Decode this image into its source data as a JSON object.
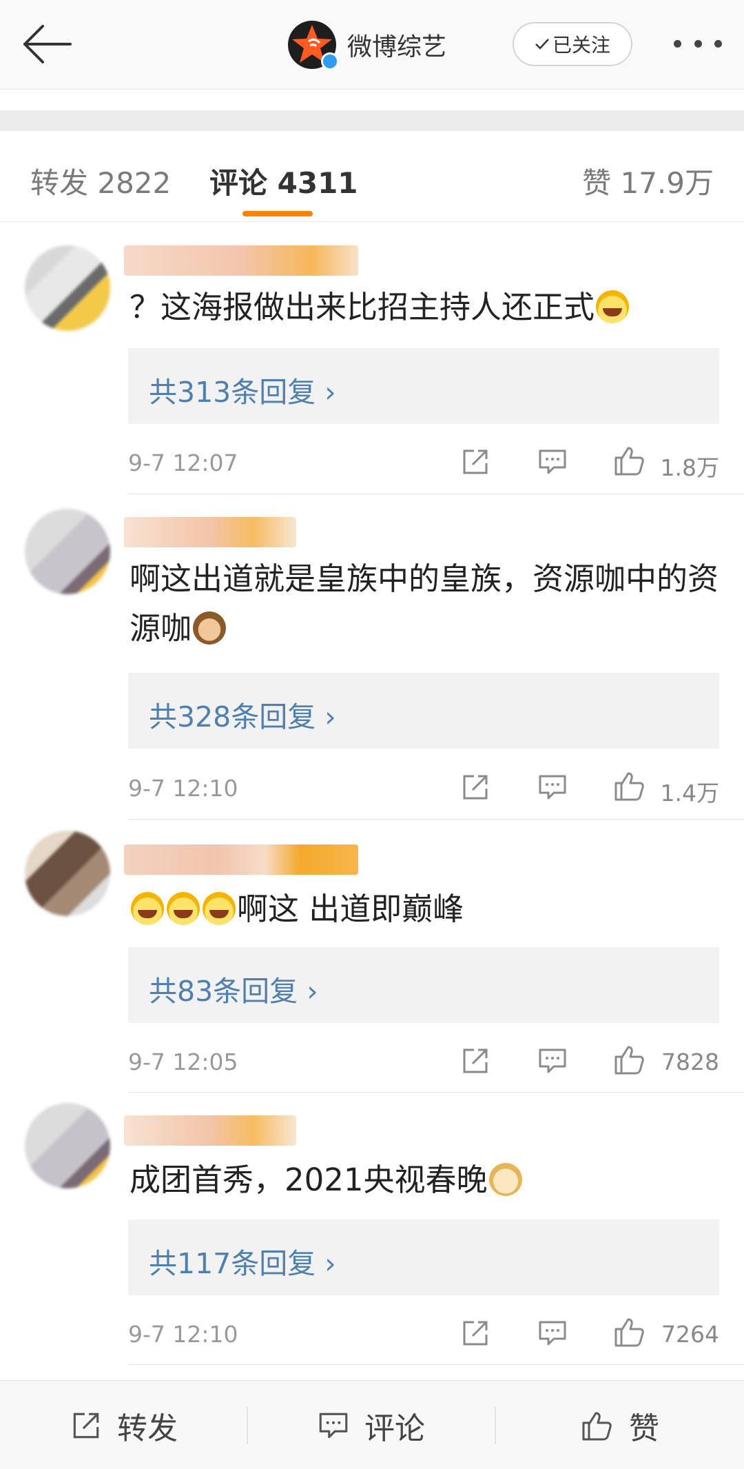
{
  "account": {
    "name": "微博综艺",
    "follow_label": "已关注"
  },
  "tabs": {
    "repost": "转发 2822",
    "comments": "评论 4311",
    "likes": "赞 17.9万"
  },
  "comments": [
    {
      "text_before": "？这海报做出来比招主持人还正式",
      "emoji": "laugh-cry",
      "text_after": "",
      "replies": "共313条回复 ›",
      "time": "9-7 12:07",
      "likes": "1.8万"
    },
    {
      "text_before": "啊这出道就是皇族中的皇族，资源咖中的资源咖",
      "emoji": "see-no-evil-monkey",
      "text_after": "",
      "replies": "共328条回复 ›",
      "time": "9-7 12:10",
      "likes": "1.4万"
    },
    {
      "text_before": "",
      "emoji": "laugh-cry",
      "text_after": "啊这 出道即巅峰",
      "replies": "共83条回复 ›",
      "time": "9-7 12:05",
      "likes": "7828"
    },
    {
      "text_before": "成团首秀，2021央视春晚",
      "emoji": "doge",
      "text_after": "",
      "replies": "共117条回复 ›",
      "time": "9-7 12:10",
      "likes": "7264"
    }
  ],
  "bottom_bar": {
    "repost": "转发",
    "comment": "评论",
    "like": "赞"
  },
  "colors": {
    "accent": "#ff8200",
    "link": "#4f7fb0",
    "verified": "#2d9cf2"
  }
}
